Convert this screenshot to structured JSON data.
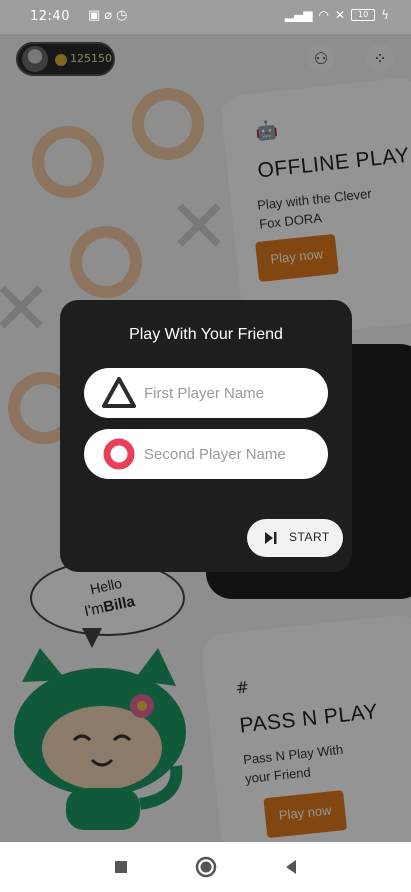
{
  "status_bar": {
    "time": "12:40",
    "battery": "10"
  },
  "top_bar": {
    "coins": "125150",
    "colors": {
      "pill": "#2a2a2a",
      "coin": "#d9b13a"
    }
  },
  "offline_card": {
    "title": "OFFLINE PLAY",
    "description": "Play with the Clever Fox DORA",
    "button": "Play now",
    "icon": "robot-icon"
  },
  "pass_card": {
    "title": "PASS N PLAY",
    "description": "Pass N Play With your Friend",
    "button": "Play now",
    "icon": "tic-tac-toe-icon"
  },
  "mascot": {
    "greeting_line1": "Hello",
    "greeting_prefix": "I'm",
    "greeting_name": "Billa"
  },
  "modal": {
    "title": "Play With Your Friend",
    "first_player_placeholder": "First Player Name",
    "second_player_placeholder": "Second Player Name",
    "first_player_value": "",
    "second_player_value": "",
    "start_label": "START",
    "colors": {
      "triangle": "#2b2b2b",
      "circle": "#e8405a",
      "accent": "#e07b1c"
    }
  }
}
